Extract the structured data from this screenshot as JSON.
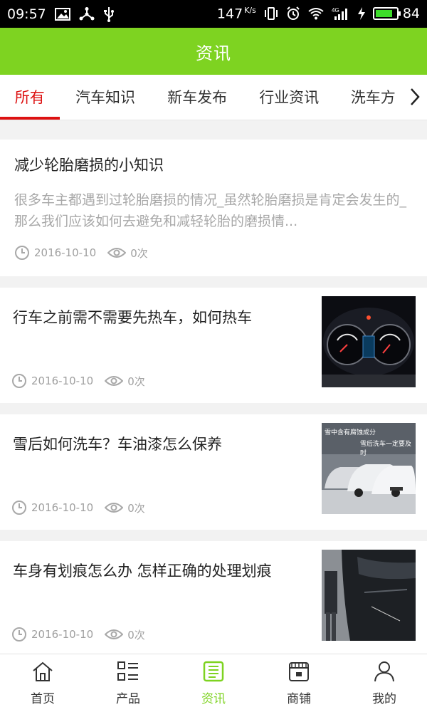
{
  "statusbar": {
    "time": "09:57",
    "speed": "147",
    "speed_unit": "K/s",
    "battery": "84",
    "battery_level": 0.84
  },
  "header": {
    "title": "资讯"
  },
  "tabs": [
    {
      "label": "所有",
      "active": true
    },
    {
      "label": "汽车知识"
    },
    {
      "label": "新车发布"
    },
    {
      "label": "行业资讯"
    },
    {
      "label": "洗车方"
    }
  ],
  "articles": [
    {
      "title": "减少轮胎磨损的小知识",
      "desc": "很多车主都遇到过轮胎磨损的情况_虽然轮胎磨损是肯定会发生的_那么我们应该如何去避免和减轻轮胎的磨损情...",
      "date": "2016-10-10",
      "views": "0次"
    },
    {
      "title": "行车之前需不需要先热车，如何热车",
      "date": "2016-10-10",
      "views": "0次",
      "image": "car-dashboard"
    },
    {
      "title": "雪后如何洗车？车油漆怎么保养",
      "date": "2016-10-10",
      "views": "0次",
      "image": "snow-cars",
      "image_caption_1": "雪中含有腐蚀成分",
      "image_caption_2": "雪后洗车一定要及时"
    },
    {
      "title": "车身有划痕怎么办 怎样正确的处理划痕",
      "date": "2016-10-10",
      "views": "0次",
      "image": "car-scratch"
    }
  ],
  "bottomnav": [
    {
      "label": "首页",
      "icon": "home-icon"
    },
    {
      "label": "产品",
      "icon": "grid-list-icon"
    },
    {
      "label": "资讯",
      "icon": "news-icon",
      "active": true
    },
    {
      "label": "商铺",
      "icon": "shop-icon"
    },
    {
      "label": "我的",
      "icon": "user-icon"
    }
  ],
  "colors": {
    "brand_green": "#7ed321",
    "active_red": "#dd1111",
    "meta_gray": "#a0a0a0"
  }
}
